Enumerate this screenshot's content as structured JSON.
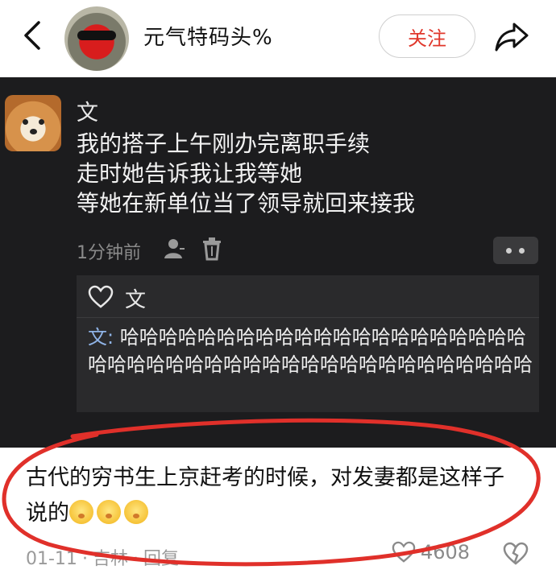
{
  "header": {
    "channel_name": "元气特码头%",
    "follow_label": "关注"
  },
  "post": {
    "author": "文",
    "body_lines": [
      "我的搭子上午刚办完离职手续",
      "走时她告诉我让我等她",
      "等她在新单位当了领导就回来接我"
    ],
    "time": "1分钟前",
    "liker": "文",
    "reply_author": "文:",
    "reply_body": " 哈哈哈哈哈哈哈哈哈哈哈哈哈哈哈哈哈哈哈哈哈哈哈哈哈哈哈哈哈哈哈哈哈哈哈哈哈哈哈哈哈哈哈哈"
  },
  "comment": {
    "text_line1": "古代的穷书生上京赶考的时候，对发妻都是这样子",
    "text_line2": "说的",
    "date": "01-11",
    "location": "吉林",
    "reply_label": "回复",
    "like_count": "4608"
  },
  "colors": {
    "accent_red": "#e0372b",
    "dark_bg": "#1c1c1e",
    "annotation_red": "#e0302a"
  }
}
